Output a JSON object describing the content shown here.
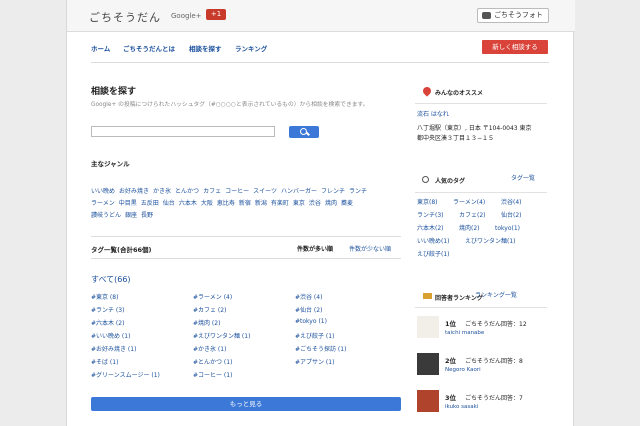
{
  "header": {
    "logo": "ごちそうだん",
    "logo_sub": "Google+",
    "gplus": "+1",
    "photo_button": "ごちそうフォト"
  },
  "nav": {
    "items": [
      "ホーム",
      "ごちそうだんとは",
      "相談を探す",
      "ランキング"
    ],
    "new_button": "新しく相談する"
  },
  "main": {
    "title": "相談を探す",
    "desc": "Google+ の投稿につけられたハッシュタグ（#○○○○と表示されているもの）から相談を検索できます。"
  },
  "genre": {
    "title": "主なジャンル",
    "items": [
      "いい晩め",
      "お好み焼き",
      "かき氷",
      "とんかつ",
      "カフェ",
      "コーヒー",
      "スイーツ",
      "ハンバーガー",
      "フレンチ",
      "ランチ",
      "ラーメン",
      "中目黒",
      "五反田",
      "仙台",
      "六本木",
      "大阪",
      "恵比寿",
      "新宿",
      "新潟",
      "有楽町",
      "東京",
      "渋谷",
      "焼肉",
      "蕎麦",
      "讃岐うどん",
      "銀座",
      "長野"
    ]
  },
  "tag_list": {
    "title": "タグ一覧(合計66個)",
    "sort_active": "件数が多い順",
    "sort_other": "件数が少ない順",
    "all": "すべて(66)",
    "tags": [
      [
        "#東京 (8)",
        "#ラーメン (4)",
        "#渋谷 (4)"
      ],
      [
        "#ランチ (3)",
        "#カフェ (2)",
        "#仙台 (2)"
      ],
      [
        "#六本木 (2)",
        "#焼肉 (2)",
        "#tokyo (1)"
      ],
      [
        "#いい晩め (1)",
        "#えびワンタン麺 (1)",
        "#えび餃子 (1)"
      ],
      [
        "#お好み焼き (1)",
        "#かき氷 (1)",
        "#ごちそう探訪 (1)"
      ],
      [
        "#そば (1)",
        "#とんかつ (1)",
        "#アプサン (1)"
      ],
      [
        "#グリーンスムージー (1)",
        "#コーヒー (1)",
        ""
      ]
    ],
    "more": "もっと見る"
  },
  "sidebar": {
    "recommend_title": "みんなのオススメ",
    "shop": "流石 はなれ",
    "address": [
      "八丁堀駅（東京）, 日本 〒104-0043 東京",
      "都中央区湊３丁目１３−１５"
    ],
    "popular_title": "人気のタグ",
    "popular_link": "タグ一覧",
    "popular": [
      [
        "東京(8)",
        "ラーメン(4)",
        "渋谷(4)"
      ],
      [
        "ランチ(3)",
        "カフェ(2)",
        "仙台(2)"
      ],
      [
        "六本木(2)",
        "焼肉(2)",
        "tokyo(1)"
      ],
      [
        "いい晩め(1)",
        "えびワンタン麺(1)",
        ""
      ],
      [
        "えび餃子(1)",
        "",
        ""
      ]
    ],
    "ranking_title": "回答者ランキング",
    "ranking_link": "ランキング一覧",
    "ranks": [
      {
        "rank": "1位",
        "label": "ごちそうだん回答：12",
        "name": "taichi manabe"
      },
      {
        "rank": "2位",
        "label": "ごちそうだん回答：8",
        "name": "Negoro Kaori"
      },
      {
        "rank": "3位",
        "label": "ごちそうだん回答：7",
        "name": "ikuko sasaki"
      }
    ]
  }
}
